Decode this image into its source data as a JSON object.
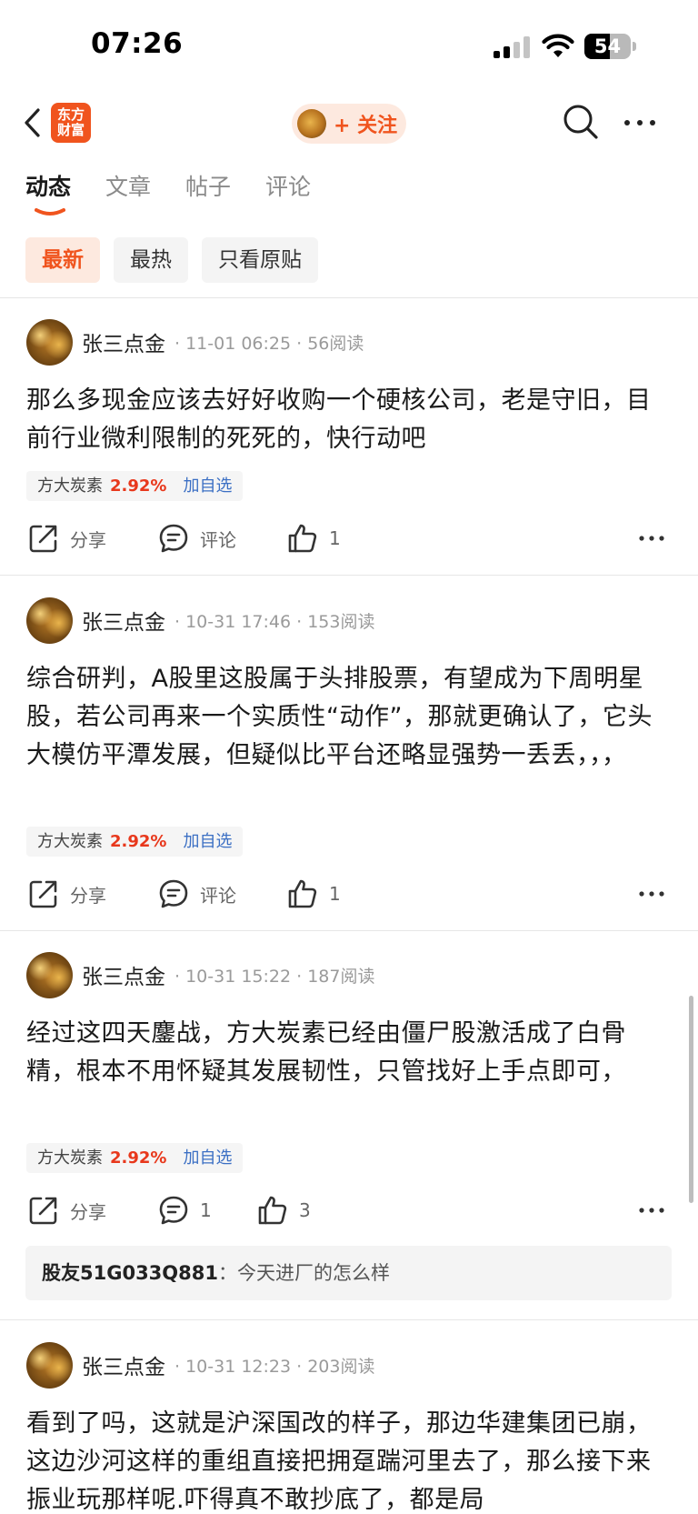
{
  "status_bar": {
    "time": "07:26",
    "battery": "54",
    "battery_level": 0.54
  },
  "header": {
    "logo_text": "东方财富",
    "follow_label": "+ 关注"
  },
  "tabs": [
    {
      "label": "动态",
      "active": true
    },
    {
      "label": "文章",
      "active": false
    },
    {
      "label": "帖子",
      "active": false
    },
    {
      "label": "评论",
      "active": false
    }
  ],
  "filters": [
    {
      "label": "最新",
      "active": true
    },
    {
      "label": "最热",
      "active": false
    },
    {
      "label": "只看原贴",
      "active": false
    }
  ],
  "posts": [
    {
      "author": "张三点金",
      "meta": "· 11-01 06:25 · 56阅读",
      "text": "那么多现金应该去好好收购一个硬核公司，老是守旧，目前行业微利限制的死死的，快行动吧",
      "stock": {
        "name": "方大炭素",
        "change": "2.92%",
        "add_label": "加自选"
      },
      "share_label": "分享",
      "comment_label": "评论",
      "likes": "1"
    },
    {
      "author": "张三点金",
      "meta": "· 10-31 17:46 · 153阅读",
      "text": "综合研判，A股里这股属于头排股票，有望成为下周明星股，若公司再来一个实质性“动作”，那就更确认了，它头大模仿平潭发展，但疑似比平台还略显强势一丢丢，，，",
      "stock": {
        "name": "方大炭素",
        "change": "2.92%",
        "add_label": "加自选"
      },
      "share_label": "分享",
      "comment_label": "评论",
      "likes": "1"
    },
    {
      "author": "张三点金",
      "meta": "· 10-31 15:22 · 187阅读",
      "text": "经过这四天鏖战，方大炭素已经由僵尸股激活成了白骨精，根本不用怀疑其发展韧性，只管找好上手点即可，",
      "stock": {
        "name": "方大炭素",
        "change": "2.92%",
        "add_label": "加自选"
      },
      "share_label": "分享",
      "comment_label": "1",
      "likes": "3",
      "reply": {
        "user": "股友51G033Q881",
        "separator": "：",
        "text": "今天进厂的怎么样"
      }
    },
    {
      "author": "张三点金",
      "meta": "· 10-31 12:23 · 203阅读",
      "text": "看到了吗，这就是沪深国改的样子，那边华建集团已崩，这边沙河这样的重组直接把拥趸踹河里去了，那么接下来振业玩那样呢.吓得真不敢抄底了，都是局"
    }
  ]
}
